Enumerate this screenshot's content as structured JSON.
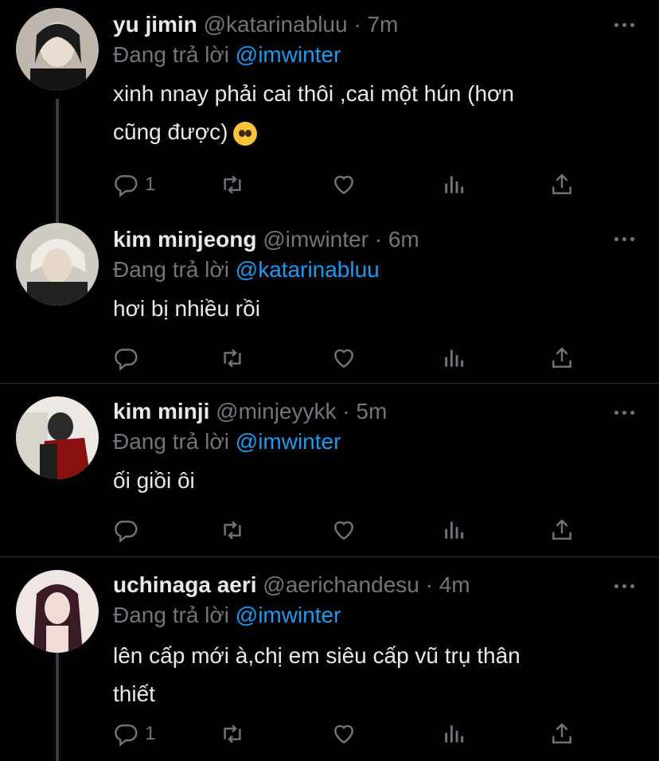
{
  "replying_prefix": "Đang trả lời",
  "tweets": [
    {
      "name": "yu jimin",
      "handle": "@katarinabluu",
      "time": "7m",
      "reply_to": "@imwinter",
      "text_line1": "xinh nnay phải cai thôi ,cai một hún (hơn",
      "text_line2": "cũng được)",
      "emoji": "pleading-face-emoji",
      "reply_count": "1",
      "avatar_colors": [
        "#bfb7ae",
        "#1a1a1a"
      ]
    },
    {
      "name": "kim minjeong",
      "handle": "@imwinter",
      "time": "6m",
      "reply_to": "@katarinabluu",
      "text_line1": "hơi bị nhiều rồi",
      "reply_count": "",
      "avatar_colors": [
        "#d9d6cf",
        "#2b2b2b"
      ]
    },
    {
      "name": "kim minji",
      "handle": "@minjeyykk",
      "time": "5m",
      "reply_to": "@imwinter",
      "text_line1": "ối giồi ôi",
      "reply_count": "",
      "avatar_colors": [
        "#e8e5df",
        "#8a1010"
      ]
    },
    {
      "name": "uchinaga aeri",
      "handle": "@aerichandesu",
      "time": "4m",
      "reply_to": "@imwinter",
      "text_line1": "lên cấp mới à,chị em siêu cấp vũ trụ thân",
      "text_line2": "thiết",
      "reply_count": "1",
      "avatar_colors": [
        "#e6d3cf",
        "#3a1a24"
      ]
    }
  ],
  "icons": {
    "reply": "reply-icon",
    "retweet": "retweet-icon",
    "like": "like-icon",
    "views": "views-icon",
    "share": "share-icon",
    "more": "more-icon"
  },
  "colors": {
    "background": "#000000",
    "text": "#e7e9ea",
    "muted": "#71767b",
    "accent": "#1d9bf0",
    "divider": "#2f3336"
  }
}
